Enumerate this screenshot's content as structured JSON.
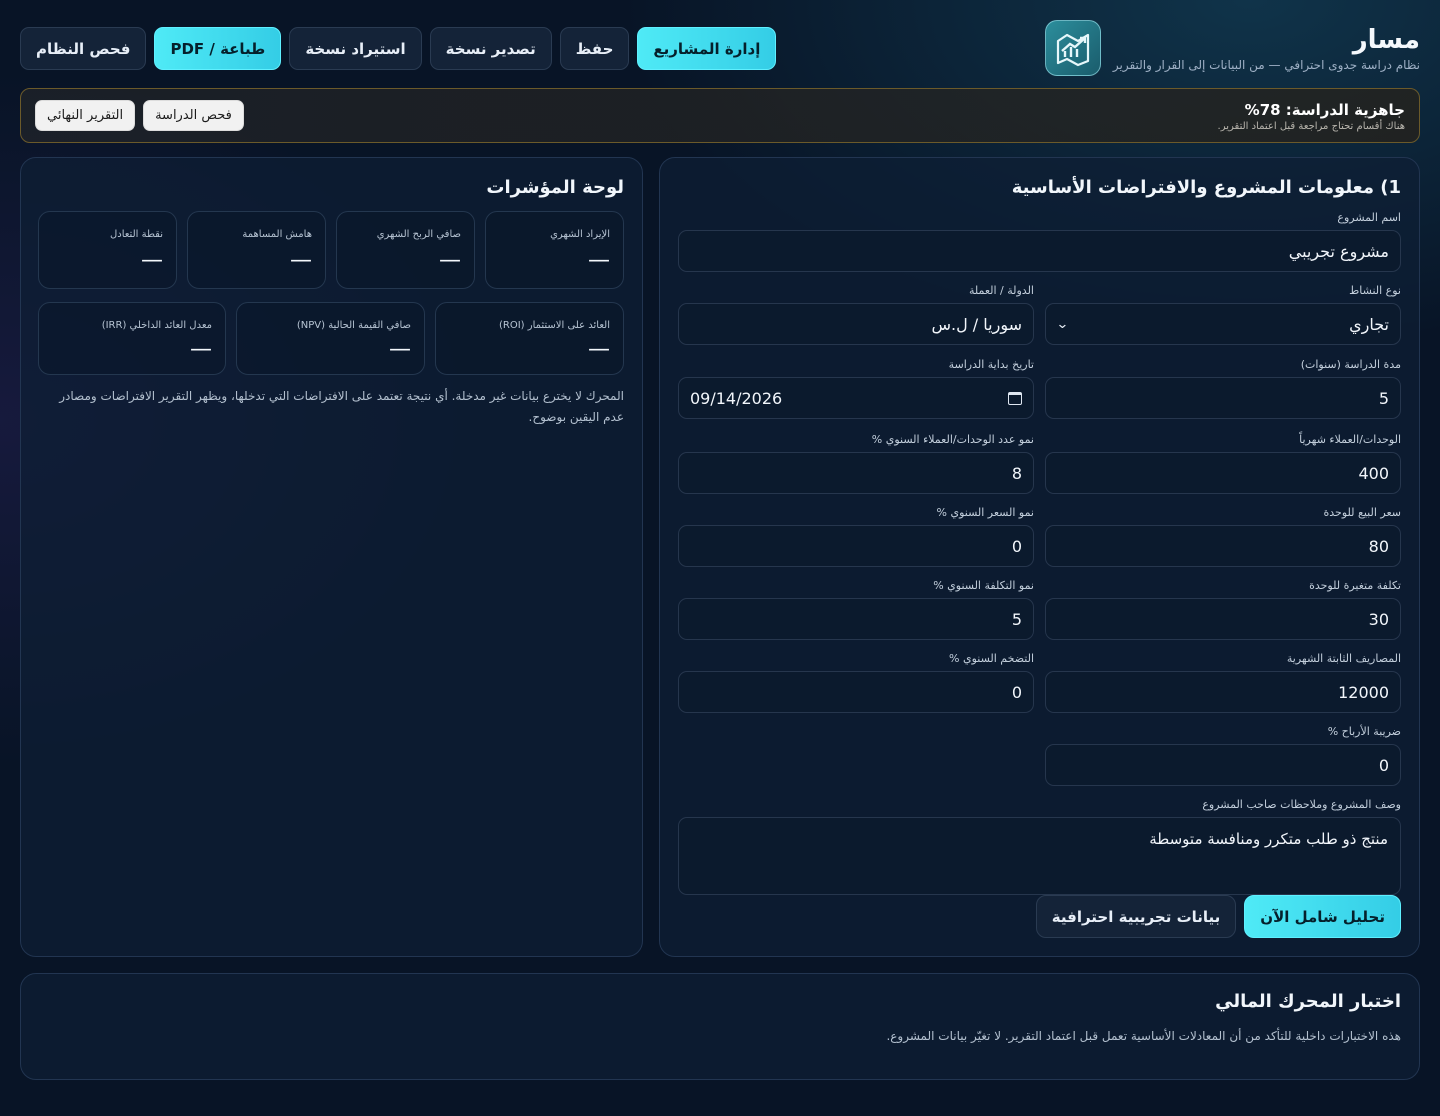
{
  "brand": {
    "title": "مسار",
    "subtitle": "نظام دراسة جدوى احترافي — من البيانات إلى القرار والتقرير",
    "logo_icon": "rising-chart-icon"
  },
  "toolbar": {
    "projects": "إدارة المشاريع",
    "save": "حفظ",
    "export": "تصدير نسخة",
    "import": "استيراد نسخة",
    "print": "طباعة / PDF",
    "system_check": "فحص النظام"
  },
  "readiness": {
    "title": "جاهزية الدراسة: 78%",
    "value_percent": 78,
    "note": "هناك أقسام تحتاج مراجعة قبل اعتماد التقرير.",
    "check_button": "فحص الدراسة",
    "report_button": "التقرير النهائي"
  },
  "form": {
    "title": "1) معلومات المشروع والافتراضات الأساسية",
    "project_name": {
      "label": "اسم المشروع",
      "value": "مشروع تجريبي"
    },
    "activity_type": {
      "label": "نوع النشاط",
      "value": "تجاري"
    },
    "country_currency": {
      "label": "الدولة / العملة",
      "value": "سوريا / ل.س"
    },
    "study_years": {
      "label": "مدة الدراسة (سنوات)",
      "value": "5"
    },
    "start_date": {
      "label": "تاريخ بداية الدراسة",
      "value": "09/14/2026"
    },
    "monthly_units": {
      "label": "الوحدات/العملاء شهرياً",
      "value": "400"
    },
    "units_growth": {
      "label": "نمو عدد الوحدات/العملاء السنوي %",
      "value": "8"
    },
    "unit_price": {
      "label": "سعر البيع للوحدة",
      "value": "80"
    },
    "price_growth": {
      "label": "نمو السعر السنوي %",
      "value": "0"
    },
    "variable_cost": {
      "label": "تكلفة متغيرة للوحدة",
      "value": "30"
    },
    "cost_growth": {
      "label": "نمو التكلفة السنوي %",
      "value": "5"
    },
    "fixed_costs": {
      "label": "المصاريف الثابتة الشهرية",
      "value": "12000"
    },
    "inflation": {
      "label": "التضخم السنوي %",
      "value": "0"
    },
    "profit_tax": {
      "label": "ضريبة الأرباح %",
      "value": "0"
    },
    "description": {
      "label": "وصف المشروع وملاحظات صاحب المشروع",
      "value": "منتج ذو طلب متكرر ومنافسة متوسطة"
    },
    "analyze_button": "تحليل شامل الآن",
    "demo_button": "بيانات تجريبية احترافية"
  },
  "dashboard": {
    "title": "لوحة المؤشرات",
    "kpis_row1": [
      {
        "label": "الإيراد الشهري",
        "value": "—"
      },
      {
        "label": "صافي الربح الشهري",
        "value": "—"
      },
      {
        "label": "هامش المساهمة",
        "value": "—"
      },
      {
        "label": "نقطة التعادل",
        "value": "—"
      }
    ],
    "kpis_row2": [
      {
        "label": "العائد على الاستثمار (ROI)",
        "value": "—"
      },
      {
        "label": "صافي القيمة الحالية (NPV)",
        "value": "—"
      },
      {
        "label": "معدل العائد الداخلي (IRR)",
        "value": "—"
      }
    ],
    "note": "المحرك لا يخترع بيانات غير مدخلة. أي نتيجة تعتمد على الافتراضات التي تدخلها، ويظهر التقرير الافتراضات ومصادر عدم اليقين بوضوح."
  },
  "engine_test": {
    "title": "اختبار المحرك المالي",
    "note": "هذه الاختبارات داخلية للتأكد من أن المعادلات الأساسية تعمل قبل اعتماد التقرير. لا تغيّر بيانات المشروع."
  },
  "colors": {
    "background": "#081426",
    "accent": "#4feaf6",
    "panel": "#0e1e34",
    "warning_border": "#6b5a2a"
  }
}
